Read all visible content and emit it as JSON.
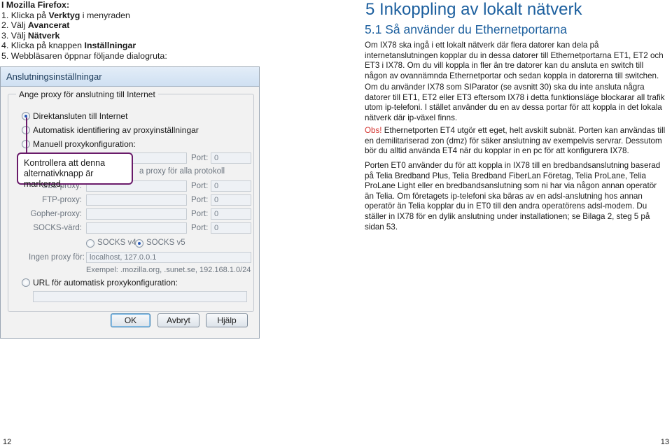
{
  "left": {
    "intro": "I Mozilla Firefox:",
    "steps": [
      {
        "num": "1.",
        "pre": "Klicka på ",
        "bold": "Verktyg",
        "post": " i menyraden"
      },
      {
        "num": "2.",
        "pre": "Välj ",
        "bold": "Avancerat",
        "post": ""
      },
      {
        "num": "3.",
        "pre": "Välj ",
        "bold": "Nätverk",
        "post": ""
      },
      {
        "num": "4.",
        "pre": "Klicka på knappen ",
        "bold": "Inställningar",
        "post": ""
      },
      {
        "num": "5.",
        "pre": "Webbläsaren öppnar följande dialogruta:",
        "bold": "",
        "post": ""
      }
    ],
    "callout": "Kontrollera att denna alternativknapp är markerad.",
    "page_number": "12"
  },
  "dialog": {
    "title": "Anslutningsinställningar",
    "group_title": "Ange proxy för anslutning till Internet",
    "options": {
      "direct": "Direktansluten till Internet",
      "auto_detect": "Automatisk identifiering av proxyinställningar",
      "manual": "Manuell proxykonfiguration:",
      "auto_url": "URL för automatisk proxykonfiguration:"
    },
    "same_proxy": "a proxy för alla protokoll",
    "fields": {
      "ssl": "SSL-proxy:",
      "ftp": "FTP-proxy:",
      "gopher": "Gopher-proxy:",
      "socks": "SOCKS-värd:"
    },
    "port_label": "Port:",
    "port_value": "0",
    "socks_v4": "SOCKS v4",
    "socks_v5": "SOCKS v5",
    "no_proxy_label": "Ingen proxy för:",
    "no_proxy_value": "localhost, 127.0.0.1",
    "example": "Exempel: .mozilla.org, .sunet.se, 192.168.1.0/24",
    "buttons": {
      "ok": "OK",
      "cancel": "Avbryt",
      "help": "Hjälp"
    },
    "selected_option": "direct"
  },
  "right": {
    "chapter": "5  Inkoppling av lokalt nätverk",
    "section": "5.1  Så använder du Ethernetportarna",
    "p1": "Om IX78 ska ingå i ett lokalt nätverk där flera datorer kan dela på internetanslutningen kopplar du in dessa datorer till Ethernetportarna ET1, ET2 och ET3 i IX78. Om du vill koppla in fler än tre datorer kan du ansluta en switch till någon av ovannämnda Ethernetportar och sedan koppla in datorerna till switchen.",
    "p2": "Om du använder IX78 som SIParator (se avsnitt 30) ska du inte ansluta några datorer till ET1, ET2 eller ET3 eftersom IX78 i detta funktionsläge blockarar all trafik utom ip-telefoni. I stället använder du en av dessa portar för att koppla in det lokala nätverk där ip-växel finns.",
    "p3_obs": "Obs!",
    "p3": " Ethernetporten ET4 utgör ett eget, helt avskilt subnät. Porten kan användas till en demilitariserad zon (dmz) för säker anslutning av exempelvis servrar. Dessutom bör du alltid använda ET4 när du kopplar in en pc för att konfigurera IX78.",
    "p4": "Porten ET0 använder du för att koppla in IX78 till en bredbandsanslutning baserad på Telia Bredband Plus, Telia Bredband FiberLan Företag, Telia ProLane, Telia ProLane Light eller en bredbandsanslutning som ni har via någon annan operatör än Telia. Om företagets ip-telefoni ska bäras av en adsl-anslutning hos annan operatör än Telia kopplar du in ET0 till den andra operatörens adsl-modem. Du ställer in IX78 för en dylik anslutning under installationen; se Bilaga 2, steg 5 på sidan 53.",
    "page_number": "13"
  }
}
